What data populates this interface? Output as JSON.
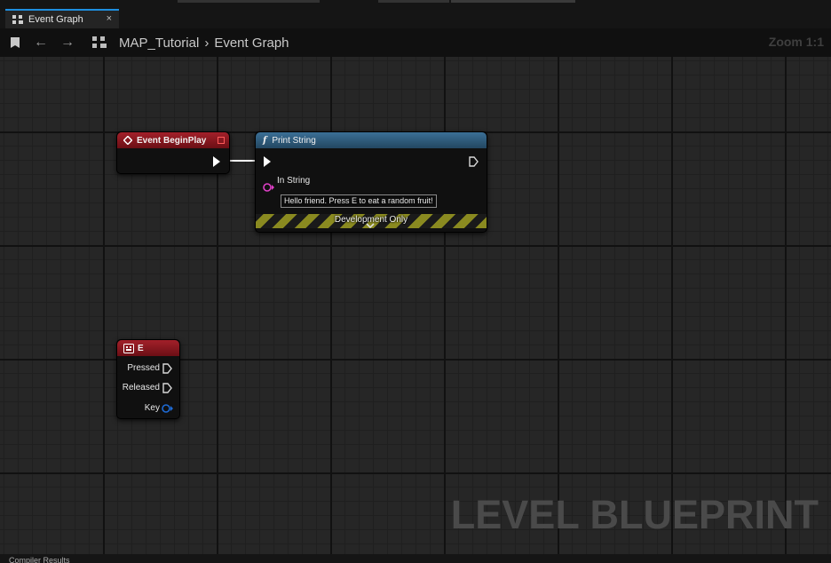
{
  "tab": {
    "label": "Event Graph",
    "close": "×"
  },
  "toolbar": {
    "back": "←",
    "forward": "→"
  },
  "breadcrumb": {
    "root": "MAP_Tutorial",
    "separator": "›",
    "current": "Event Graph"
  },
  "zoom": "Zoom 1:1",
  "watermark": "LEVEL BLUEPRINT",
  "nodes": {
    "begin_play": {
      "title": "Event BeginPlay"
    },
    "print_string": {
      "title": "Print String",
      "func_glyph": "f",
      "in_string_label": "In String",
      "in_string_value": "Hello friend. Press E to eat a random fruit!",
      "dev_only": "Development Only",
      "expand": "⌄"
    },
    "key_e": {
      "title": "E",
      "pins": [
        "Pressed",
        "Released",
        "Key"
      ]
    }
  },
  "bottom": {
    "tab_label": "Compiler Results"
  },
  "colors": {
    "event_red": "#a3202a",
    "function_blue": "#3b6f96",
    "string_pin": "#e040c8",
    "struct_pin": "#1e6bd6",
    "tab_accent": "#1e8fe0"
  }
}
